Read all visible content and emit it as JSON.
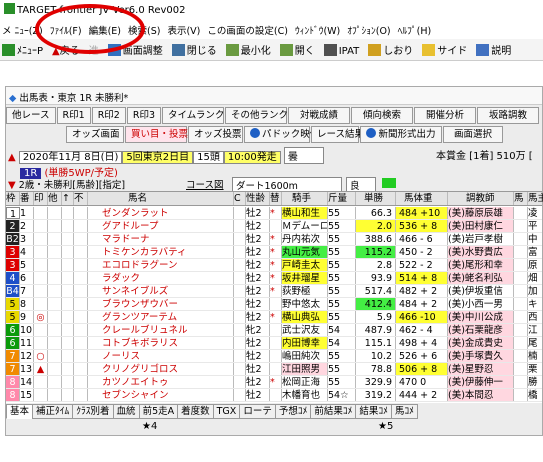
{
  "window": {
    "title": "TARGET frontier JV  Ver6.0   Rev002"
  },
  "menu": [
    "メ ﾆｭｰ(Z)",
    "ﾌｧｲﾙ(F)",
    "編集(E)",
    "検索(S)",
    "表示(V)",
    "この画面の設定(C)",
    "ｳｨﾝﾄﾞｳ(W)",
    "ｵﾌﾟｼｮﾝ(O)",
    "ﾍﾙﾌﾟ(H)"
  ],
  "toolbar": [
    "ﾒﾆｭｰP",
    "戻る",
    "進",
    "画面調整",
    "閉じる",
    "最小化",
    "開く",
    "IPAT",
    "しおり",
    "サイド",
    "説明"
  ],
  "panel": {
    "title": "出馬表・東京 1R 未勝利*",
    "row1": [
      "他レース",
      "R印1",
      "R印2",
      "R印3",
      "タイムランク",
      "その他ランク",
      "対戦成績",
      "傾向検索",
      "開催分析",
      "坂路調教"
    ],
    "row2": [
      "オッズ画面",
      "買い目・投票",
      "オッズ投票",
      "パドック映像",
      "レース結果",
      "新聞形式出力",
      "画面選択"
    ],
    "info": {
      "date": "2020年11月 8日(日)",
      "meet": "5回東京2日目",
      "race_no": "15頭",
      "post_time": "10:00発走",
      "weather": "曇",
      "race_label": "1R",
      "race_name": "(単勝5WP/予定)",
      "cond": "2歳・未勝利[馬齢][指定]",
      "course": "コース図",
      "track": "ダート1600m",
      "going": "良",
      "prize": "本賞金 [1着] 510万 ["
    },
    "columns": [
      "枠",
      "番",
      "印",
      "他",
      "↑",
      "不",
      "馬名",
      "C",
      "性齢",
      "替",
      "騎手",
      "斤量",
      "単勝",
      "馬体重",
      "調教師",
      "馬",
      "馬主"
    ],
    "horses": [
      {
        "w": "1",
        "no": "1",
        "mk": "",
        "name": "ゼンダンラット",
        "sex": "牡2",
        "kae": "*",
        "jockey": "横山和生",
        "kin": "55",
        "odds": "66.3",
        "wt": "484 +10",
        "tr": "(美)藤原辰雄",
        "own": "凌"
      },
      {
        "w": "2",
        "no": "2",
        "mk": "",
        "name": "グアドループ",
        "sex": "牡2",
        "kae": "",
        "jockey": "Ｍデムーロ",
        "kin": "55",
        "odds": "2.0",
        "wt": "536 + 8",
        "tr": "(美)田村康仁",
        "own": "平"
      },
      {
        "w": "B2",
        "no": "3",
        "mk": "",
        "name": "マラドーナ",
        "sex": "牡2",
        "kae": "*",
        "jockey": "丹内祐次",
        "kin": "55",
        "odds": "388.6",
        "wt": "466 - 6",
        "tr": "(美)岩戸孝樹",
        "own": "中"
      },
      {
        "w": "3",
        "no": "4",
        "mk": "",
        "name": "トミケンカラバティ",
        "sex": "牡2",
        "kae": "*",
        "jockey": "丸山元気",
        "kin": "55",
        "odds": "115.2",
        "wt": "450 - 2",
        "tr": "(美)水野貴広",
        "own": "富"
      },
      {
        "w": "3",
        "no": "5",
        "mk": "",
        "name": "エコロドラグーン",
        "sex": "牡2",
        "kae": "*",
        "jockey": "戸崎圭太",
        "kin": "55",
        "odds": "2.8",
        "wt": "522 - 2",
        "tr": "(美)尾形和幸",
        "own": "原"
      },
      {
        "w": "4",
        "no": "6",
        "mk": "",
        "name": "ラダック",
        "sex": "牡2",
        "kae": "*",
        "jockey": "坂井瑠星",
        "kin": "55",
        "odds": "93.9",
        "wt": "514 + 8",
        "tr": "(美)蛯名利弘",
        "own": "畑"
      },
      {
        "w": "B4",
        "no": "7",
        "mk": "",
        "name": "サンネイブルズ",
        "sex": "牡2",
        "kae": "*",
        "jockey": "荻野極",
        "kin": "55",
        "odds": "517.4",
        "wt": "482 + 2",
        "tr": "(美)伊坂重信",
        "own": "加"
      },
      {
        "w": "5",
        "no": "8",
        "mk": "",
        "name": "ブラウンザウバー",
        "sex": "牡2",
        "kae": "",
        "jockey": "野中悠太",
        "kin": "55",
        "odds": "412.4",
        "wt": "484 + 2",
        "tr": "(美)小西一男",
        "own": "キ"
      },
      {
        "w": "5",
        "no": "9",
        "mk": "◎",
        "name": "グランツアーテム",
        "sex": "牡2",
        "kae": "*",
        "jockey": "横山典弘",
        "kin": "55",
        "odds": "5.9",
        "wt": "466 -10",
        "tr": "(美)中川公成",
        "own": "西"
      },
      {
        "w": "6",
        "no": "10",
        "mk": "",
        "name": "クレールブリュネル",
        "sex": "牝2",
        "kae": "",
        "jockey": "武士沢友",
        "kin": "54",
        "odds": "487.9",
        "wt": "462 - 4",
        "tr": "(美)石栗龍彦",
        "own": "江"
      },
      {
        "w": "6",
        "no": "11",
        "mk": "",
        "name": "コトブキボラリス",
        "sex": "牡2",
        "kae": "",
        "jockey": "内田博幸",
        "kin": "54",
        "odds": "115.1",
        "wt": "498 + 4",
        "tr": "(美)金成貴史",
        "own": "尾"
      },
      {
        "w": "7",
        "no": "12",
        "mk": "○",
        "name": "ノーリス",
        "sex": "牡2",
        "kae": "",
        "jockey": "嶋田純次",
        "kin": "55",
        "odds": "10.2",
        "wt": "526 + 6",
        "tr": "(美)手塚貴久",
        "own": "楠"
      },
      {
        "w": "7",
        "no": "13",
        "mk": "▲",
        "name": "クリノグリゴロス",
        "sex": "牡2",
        "kae": "",
        "jockey": "江田照男",
        "kin": "55",
        "odds": "78.8",
        "wt": "506 + 8",
        "tr": "(美)星野忍",
        "own": "栗"
      },
      {
        "w": "8",
        "no": "14",
        "mk": "",
        "name": "カツノエイトゥ",
        "sex": "牡2",
        "kae": "*",
        "jockey": "松岡正海",
        "kin": "55",
        "odds": "329.9",
        "wt": "470  0",
        "tr": "(美)伊藤伸一",
        "own": "勝"
      },
      {
        "w": "8",
        "no": "15",
        "mk": "",
        "name": "セブンシャイン",
        "sex": "牡2",
        "kae": "",
        "jockey": "木幡育也",
        "kin": "54☆",
        "odds": "319.2",
        "wt": "444 + 2",
        "tr": "(美)本間忍",
        "own": "橋"
      }
    ],
    "tabs": [
      "基本",
      "補正ﾀｲﾑ",
      "ｸﾗｽ別着",
      "血統",
      "前5走A",
      "着度数",
      "TGX",
      "ローテ",
      "予想ｺﾒ",
      "前結果ｺﾒ",
      "結果ｺﾒ",
      "馬ｺﾒ"
    ],
    "stars": [
      "★4",
      "★5"
    ]
  }
}
